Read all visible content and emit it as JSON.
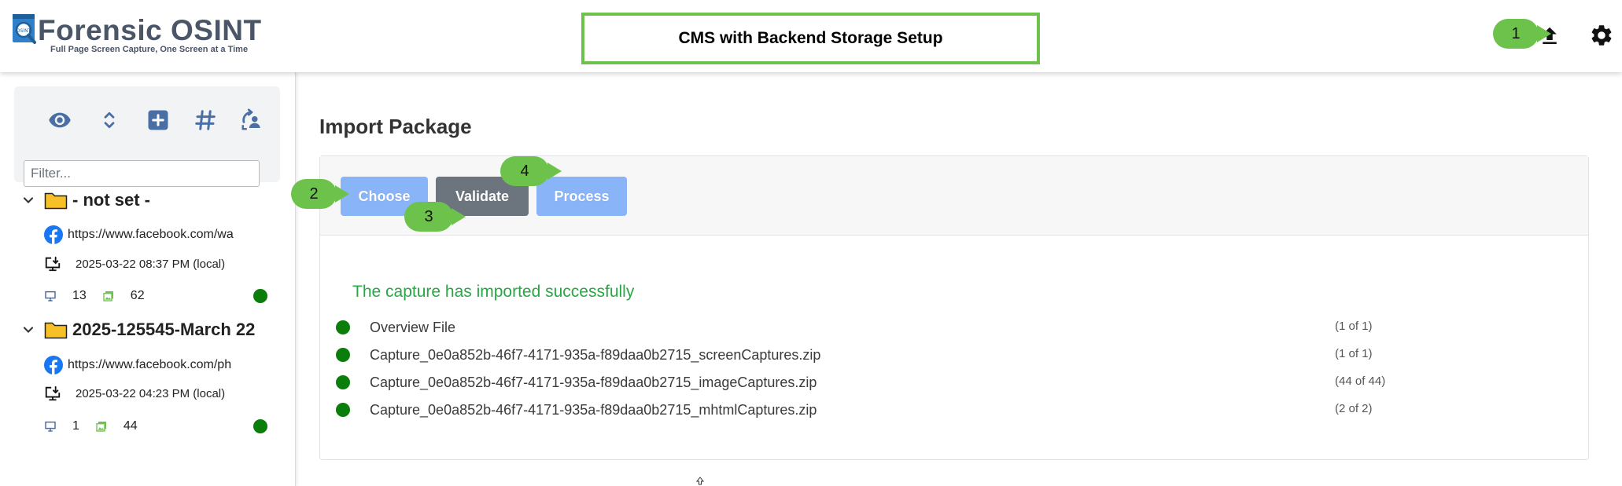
{
  "app": {
    "logo_title": "Forensic OSINT",
    "logo_tagline": "Full Page Screen Capture, One Screen at a Time",
    "banner": "CMS with Backend Storage Setup"
  },
  "header_icons": {
    "upload": "upload-icon",
    "settings": "gear-icon"
  },
  "callouts": [
    "1",
    "2",
    "3",
    "4"
  ],
  "sidebar": {
    "tools": [
      "eye-icon",
      "expand-collapse-icon",
      "add-square-icon",
      "hash-icon",
      "rotate-user-icon"
    ],
    "filter_placeholder": "Filter...",
    "folders": [
      {
        "name": "- not set -",
        "url": "https://www.facebook.com/wa",
        "date": "2025-03-22 08:37 PM (local)",
        "screens": "13",
        "images": "62",
        "status_color": "#0a7d0a"
      },
      {
        "name": "2025-125545-March 22",
        "url": "https://www.facebook.com/ph",
        "date": "2025-03-22 04:23 PM (local)",
        "screens": "1",
        "images": "44",
        "status_color": "#0a7d0a"
      }
    ]
  },
  "main": {
    "title": "Import Package",
    "buttons": {
      "choose": "Choose",
      "validate": "Validate",
      "process": "Process"
    },
    "success_message": "The capture has imported successfully",
    "files": [
      {
        "name": "Overview File",
        "count": "(1 of 1)"
      },
      {
        "name": "Capture_0e0a852b-46f7-4171-935a-f89daa0b2715_screenCaptures.zip",
        "count": "(1 of 1)"
      },
      {
        "name": "Capture_0e0a852b-46f7-4171-935a-f89daa0b2715_imageCaptures.zip",
        "count": "(44 of 44)"
      },
      {
        "name": "Capture_0e0a852b-46f7-4171-935a-f89daa0b2715_mhtmlCaptures.zip",
        "count": "(2 of 2)"
      }
    ]
  },
  "colors": {
    "accent_green": "#6cc24a",
    "status_green": "#0a7d0a",
    "success_text": "#28a745",
    "button_blue": "#8ab4f8",
    "button_gray": "#6c757d",
    "icon_blue": "#4a6fa5"
  }
}
